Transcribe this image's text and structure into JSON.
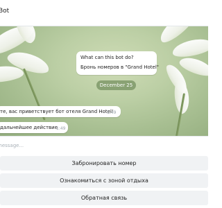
{
  "header": {
    "title": "Bot"
  },
  "info": {
    "title": "What can this bot do?",
    "body": "Бронь номеров в \"Grand Hotel\""
  },
  "date_separator": "December 25",
  "messages": [
    {
      "text": "те, вас приветствует бот отеля Grand Hotel!",
      "time": "1:49"
    },
    {
      "text": "дальнейшее действие",
      "time": "1:49"
    }
  ],
  "composer": {
    "placeholder": "message..."
  },
  "keyboard": [
    {
      "label": "Забронировать номер"
    },
    {
      "label": "Ознакомиться с зоной отдыха"
    },
    {
      "label": "Обратная связь"
    }
  ]
}
